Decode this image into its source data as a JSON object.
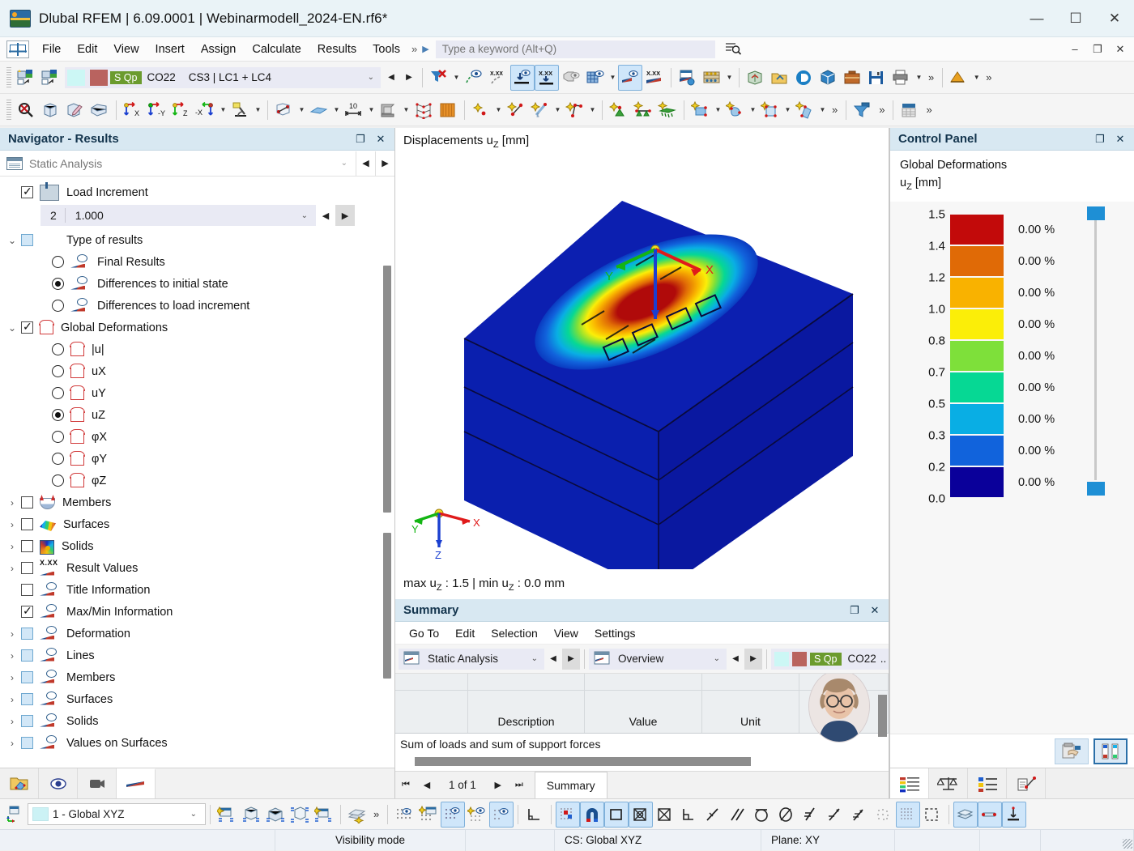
{
  "window": {
    "title": "Dlubal RFEM | 6.09.0001 | Webinarmodell_2024-EN.rf6*",
    "minimize": "—",
    "maximize": "☐",
    "close": "✕",
    "app_icon": "dlubal-logo-icon"
  },
  "menubar": {
    "items": [
      "File",
      "Edit",
      "View",
      "Insert",
      "Assign",
      "Calculate",
      "Results",
      "Tools"
    ],
    "overflow": "»",
    "play": "▶",
    "search_placeholder": "Type a keyword (Alt+Q)",
    "search_icon": "search-icon",
    "mini_minimize": "–",
    "mini_restore": "❐",
    "mini_close": "✕"
  },
  "toolbar1": {
    "loadcase": {
      "color_a": "#ccf7f5",
      "color_b": "#b9635f",
      "badge": "S Qp",
      "combination": "CO22",
      "description": "CS3 | LC1 + LC4",
      "caret": "⌄",
      "prev": "◀",
      "next": "▶"
    },
    "icons": [
      "new-model-icon",
      "open-model-icon",
      "filter-clear-icon",
      "render-visible-icon",
      "render-values-icon",
      "show-support-reactions-icon",
      "show-values-icon",
      "solid-render-icon",
      "grid-render-icon",
      "deformation-render-icon",
      "result-values-icon",
      "print-setup-icon",
      "calculator-icon",
      "import-icon",
      "export-icon",
      "dlubal-center-icon",
      "model-3d-icon",
      "briefcase-icon",
      "save-icon",
      "print-icon"
    ],
    "overflow": "»"
  },
  "toolbar2": {
    "icons": [
      "zoom-reset-icon",
      "isometric-view-icon",
      "edit-view-icon",
      "perspective-icon",
      "view-x-icon",
      "view-neg-y-icon",
      "view-z-icon",
      "view-neg-x-icon",
      "microscope-icon",
      "section-icon",
      "surface-icon",
      "dimension-icon",
      "section-profile-icon",
      "mesh-icon",
      "wall-icon",
      "new-node-icon",
      "new-line-icon",
      "new-line-tool-icon",
      "new-polyline-icon",
      "new-support-icon",
      "new-line-support-icon",
      "new-surface-support-icon",
      "new-surface-icon",
      "new-solid-icon",
      "new-opening-icon",
      "new-member-icon",
      "filter-icon",
      "table-icon"
    ],
    "overflow": "»"
  },
  "navigator": {
    "title": "Navigator - Results",
    "restore_icon": "❐",
    "close_icon": "✕",
    "analysis_select": {
      "value": "Static Analysis",
      "caret": "⌄",
      "prev": "◀",
      "next": "▶"
    },
    "load_increment": {
      "label": "Load Increment",
      "checked": true,
      "index": "2",
      "value": "1.000",
      "caret": "⌄",
      "prev": "◀",
      "next": "▶"
    },
    "tree": [
      {
        "label": "Type of results",
        "type": "group",
        "twisty": "⌄",
        "checkbox": "light",
        "indent": 0
      },
      {
        "label": "Final Results",
        "type": "radio",
        "selected": false,
        "icon": "eye-flag-icon",
        "indent": 1
      },
      {
        "label": "Differences to initial state",
        "type": "radio",
        "selected": true,
        "icon": "eye-flag-icon",
        "indent": 1
      },
      {
        "label": "Differences to load increment",
        "type": "radio",
        "selected": false,
        "icon": "eye-flag-icon",
        "indent": 1
      },
      {
        "label": "Global Deformations",
        "type": "group",
        "twisty": "⌄",
        "checkbox": "checked",
        "icon": "deformation-icon",
        "indent": 0
      },
      {
        "label": "|u|",
        "type": "radio",
        "selected": false,
        "icon": "deformation-icon",
        "indent": 1
      },
      {
        "label": "uX",
        "type": "radio",
        "selected": false,
        "icon": "deformation-icon",
        "indent": 1
      },
      {
        "label": "uY",
        "type": "radio",
        "selected": false,
        "icon": "deformation-icon",
        "indent": 1
      },
      {
        "label": "uZ",
        "type": "radio",
        "selected": true,
        "icon": "deformation-icon",
        "indent": 1
      },
      {
        "label": "φX",
        "type": "radio",
        "selected": false,
        "icon": "deformation-icon",
        "indent": 1
      },
      {
        "label": "φY",
        "type": "radio",
        "selected": false,
        "icon": "deformation-icon",
        "indent": 1
      },
      {
        "label": "φZ",
        "type": "radio",
        "selected": false,
        "icon": "deformation-icon",
        "indent": 1
      },
      {
        "label": "Members",
        "type": "node",
        "twisty": "›",
        "checkbox": "empty",
        "icon": "members-icon",
        "indent": 0
      },
      {
        "label": "Surfaces",
        "type": "node",
        "twisty": "›",
        "checkbox": "empty",
        "icon": "surfaces-icon",
        "indent": 0
      },
      {
        "label": "Solids",
        "type": "node",
        "twisty": "›",
        "checkbox": "empty",
        "icon": "solids-icon",
        "indent": 0
      },
      {
        "label": "Result Values",
        "type": "node",
        "twisty": "›",
        "checkbox": "empty",
        "icon": "result-values-icon",
        "indent": 0
      },
      {
        "label": "Title Information",
        "type": "leaf",
        "twisty": "",
        "checkbox": "empty",
        "icon": "eye-flag-icon",
        "indent": 0
      },
      {
        "label": "Max/Min Information",
        "type": "leaf",
        "twisty": "",
        "checkbox": "checked",
        "icon": "eye-flag-icon",
        "indent": 0
      },
      {
        "label": "Deformation",
        "type": "node",
        "twisty": "›",
        "checkbox": "light",
        "icon": "eye-flag-icon",
        "indent": 0
      },
      {
        "label": "Lines",
        "type": "node",
        "twisty": "›",
        "checkbox": "light",
        "icon": "eye-flag-icon",
        "indent": 0
      },
      {
        "label": "Members",
        "type": "node",
        "twisty": "›",
        "checkbox": "light",
        "icon": "eye-flag-icon",
        "indent": 0
      },
      {
        "label": "Surfaces",
        "type": "node",
        "twisty": "›",
        "checkbox": "light",
        "icon": "eye-flag-icon",
        "indent": 0
      },
      {
        "label": "Solids",
        "type": "node",
        "twisty": "›",
        "checkbox": "light",
        "icon": "eye-flag-icon",
        "indent": 0
      },
      {
        "label": "Values on Surfaces",
        "type": "node",
        "twisty": "›",
        "checkbox": "light",
        "icon": "eye-flag-icon",
        "indent": 0
      }
    ],
    "tabs": [
      "project-navigator-tab",
      "views-navigator-tab",
      "rendering-navigator-tab",
      "results-navigator-tab"
    ],
    "selected_tab": 3
  },
  "viewport": {
    "title": "Displacements u",
    "title_sub": "Z",
    "title_unit": " [mm]",
    "max_min": {
      "prefix": "max u",
      "sub1": "Z",
      "mid": " : 1.5 | min u",
      "sub2": "Z",
      "suffix": " : 0.0 mm"
    },
    "axes": {
      "x": "X",
      "y": "Y",
      "z": "Z",
      "x_color": "#e01b1b",
      "y_color": "#13b513",
      "z_color": "#1a3fd0"
    }
  },
  "control_panel": {
    "title": "Control Panel",
    "restore_icon": "❐",
    "close_icon": "✕",
    "subtitle_line1": "Global Deformations",
    "subtitle_line2_prefix": "u",
    "subtitle_line2_sub": "Z",
    "subtitle_line2_suffix": " [mm]",
    "legend": {
      "labels": [
        "1.5",
        "1.4",
        "1.2",
        "1.0",
        "0.8",
        "0.7",
        "0.5",
        "0.3",
        "0.2",
        "0.0"
      ],
      "colors": [
        "#c20a0a",
        "#e06a06",
        "#f9b200",
        "#fbee08",
        "#7ee03a",
        "#06d894",
        "#09aee4",
        "#1163dc",
        "#0a009a"
      ],
      "percents": [
        "0.00 %",
        "0.00 %",
        "0.00 %",
        "0.00 %",
        "0.00 %",
        "0.00 %",
        "0.00 %",
        "0.00 %",
        "0.00 %"
      ],
      "slider_color": "#1e8fd5"
    },
    "actions": [
      "color-picker-icon",
      "scale-edit-icon"
    ],
    "tabs": [
      "color-scale-tab",
      "factors-tab",
      "filter-tab",
      "display-props-tab"
    ],
    "selected_tab": 0
  },
  "summary": {
    "title": "Summary",
    "restore_icon": "❐",
    "close_icon": "✕",
    "menu": [
      "Go To",
      "Edit",
      "Selection",
      "View",
      "Settings"
    ],
    "analysis_combo": {
      "value": "Static Analysis",
      "caret": "⌄",
      "prev": "◀",
      "next": "▶"
    },
    "view_combo": {
      "value": "Overview",
      "caret": "⌄",
      "prev": "◀",
      "next": "▶"
    },
    "loadcase_combo": {
      "color_a": "#ccf7f5",
      "color_b": "#b9635f",
      "badge": "S Qp",
      "combination": "CO22",
      "more": "..",
      "caret": "⌄",
      "prev": "◀",
      "next": "▶"
    },
    "tool_icons": [
      "undo-icon",
      "redo-icon",
      "overflow-icon",
      "filter-icon"
    ],
    "overflow": "»",
    "table": {
      "headers": [
        "",
        "Description",
        "Value",
        "Unit",
        ""
      ],
      "rows": [
        {
          "description": "Sum of loads and sum of support forces",
          "value": "",
          "unit": ""
        }
      ]
    },
    "footer": {
      "first": "⏮",
      "prev": "◀",
      "page": "1 of 1",
      "next": "▶",
      "last": "⏭",
      "tab": "Summary"
    }
  },
  "bottombar": {
    "cs_combo": {
      "value": "1 - Global XYZ",
      "caret": "⌄"
    },
    "icons": [
      "new-view-icon",
      "view-section-icon",
      "view-clip-icon",
      "view-box-icon",
      "view-select-icon",
      "visibility-icon",
      "overflow-icon",
      "grid-snap-icon",
      "grid-new-icon",
      "grid-show-icon",
      "point-snap-icon",
      "object-snap-icon",
      "ortho-icon",
      "grid-point-icon",
      "magnet-snap-icon",
      "rect-snap-icon",
      "center-snap-icon",
      "cross-snap-icon",
      "corner-snap-icon",
      "line-snap-icon",
      "parallel-snap-icon",
      "arc-snap-icon",
      "ellipse-snap-icon",
      "perpendicular-icon",
      "tangent-icon",
      "extension-icon",
      "dotted-snap-icon",
      "grid-dense-icon",
      "selection-rect-icon",
      "layers-icon",
      "support-icon",
      "load-icon"
    ],
    "overflow": "»"
  },
  "statusbar": {
    "visibility_mode": "Visibility mode",
    "cs": "CS: Global XYZ",
    "plane": "Plane: XY"
  }
}
